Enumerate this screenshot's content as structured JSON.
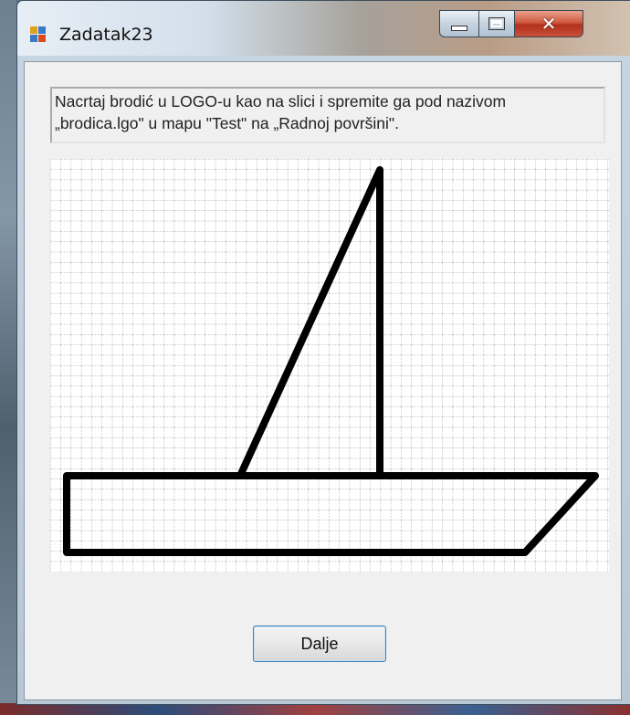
{
  "window": {
    "title": "Zadatak23",
    "icon": "app-form-icon",
    "controls": [
      "minimize-icon",
      "maximize-icon",
      "close-icon"
    ]
  },
  "instructions": {
    "text": "Nacrtaj brodić u LOGO-u kao na slici i spremite ga pod nazivom\n„brodica.lgo\" u mapu \"Test\" na „Radnoj površini\"."
  },
  "drawing": {
    "description_shapes": [
      "grid",
      "hull",
      "sail"
    ],
    "grid_color": "#a8a8a8",
    "stroke_color": "#000000"
  },
  "buttons": {
    "next_label": "Dalje"
  },
  "colors": {
    "close_button": "#c8412a",
    "button_border": "#3c7fb1"
  }
}
